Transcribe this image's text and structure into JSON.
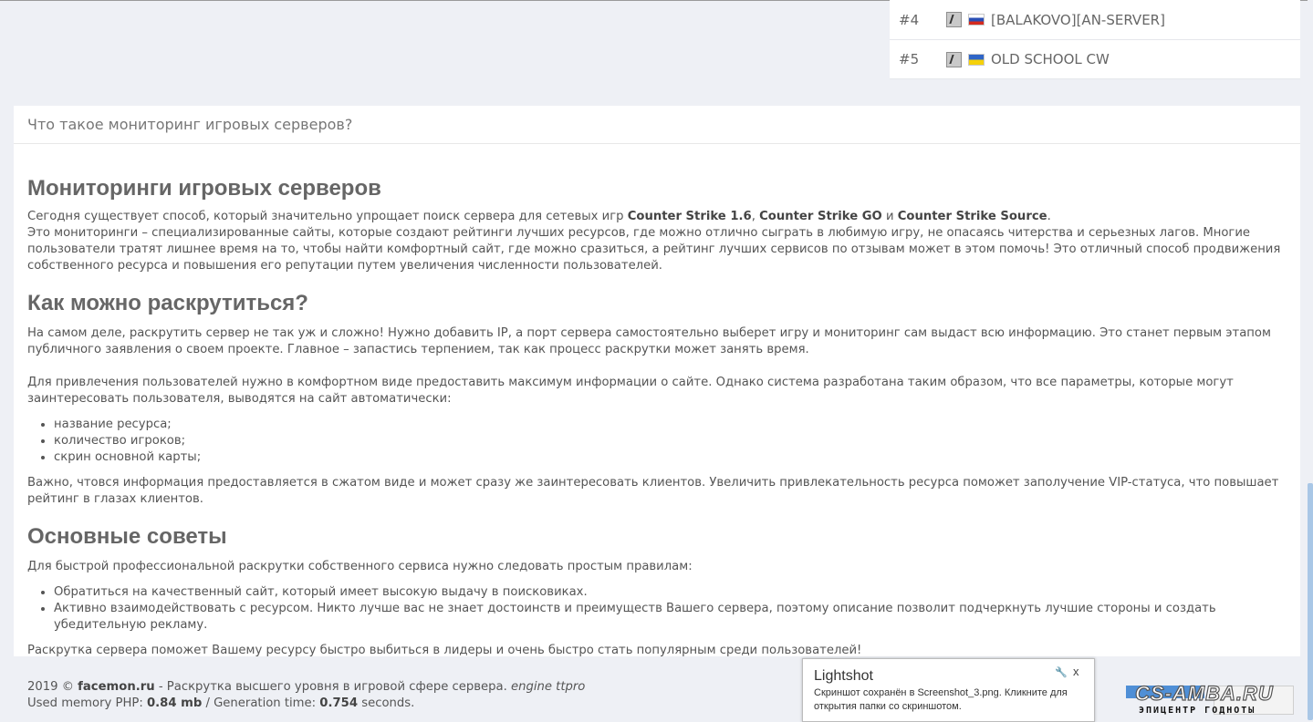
{
  "servers": [
    {
      "rank": "#4",
      "name": "[BALAKOVO][AN-SERVER]",
      "icon": "counter-strike-icon",
      "flag": "russia-flag-icon"
    },
    {
      "rank": "#5",
      "name": "OLD SCHOOL CW",
      "icon": "counter-strike-icon",
      "flag": "ukraine-flag-icon"
    }
  ],
  "faq": {
    "title": "Что такое мониторинг игровых серверов?",
    "h1": "Мониторинги игровых серверов",
    "p1_a": "Сегодня существует способ, который значительно упрощает поиск сервера для сетевых игр ",
    "p1_cs16": "Counter Strike 1.6",
    "p1_comma": ", ",
    "p1_csgo": "Counter Strike GO",
    "p1_and": " и ",
    "p1_css": "Counter Strike Source",
    "p1_dot": ".",
    "p1_b": "Это мониторинги – специализированные сайты, которые создают рейтинги лучших ресурсов, где можно отлично сыграть в любимую игру, не опасаясь читерства и серьезных лагов. Многие пользователи тратят лишнее время на то, чтобы найти комфортный сайт, где можно сразиться, а рейтинг лучших сервисов по отзывам может в этом помочь! Это отличный способ продвижения собственного ресурса и повышения его репутации путем увеличения численности пользователей.",
    "h2": "Как можно раскрутиться?",
    "p2": "На самом деле, раскрутить сервер не так уж и сложно! Нужно добавить IP, а порт сервера самостоятельно выберет игру и мониторинг сам выдаст всю информацию. Это станет первым этапом публичного заявления о своем проекте. Главное – запастись терпением, так как процесс раскрутки может занять время.",
    "p3": "Для привлечения пользователей нужно в комфортном виде предоставить максимум информации о сайте. Однако система разработана таким образом, что все параметры, которые могут заинтересовать пользователя, выводятся на сайт автоматически:",
    "list1": [
      "название ресурса;",
      "количество игроков;",
      "скрин основной карты;"
    ],
    "p4": "Важно, чтовся информация предоставляется в сжатом виде и может сразу же заинтересовать клиентов. Увеличить привлекательность ресурса поможет заполучение VIP-статуса, что повышает рейтинг в глазах клиентов.",
    "h3": "Основные советы",
    "p5": "Для быстрой профессиональной раскрутки собственного сервиса нужно следовать простым правилам:",
    "list2": [
      "Обратиться на качественный сайт, который имеет высокую выдачу в поисковиках.",
      "Активно взаимодействовать с ресурсом. Никто лучше вас не знает достоинств и преимуществ Вашего сервера, поэтому описание позволит подчеркнуть лучшие стороны и создать убедительную рекламу."
    ],
    "p6": "Раскрутка сервера поможет Вашему ресурсу быстро выбиться в лидеры и очень быстро стать популярным среди пользователей!"
  },
  "footer": {
    "year": "2019 © ",
    "site": "facemon.ru",
    "tagline": " - Раскрутка высшего уровня в игровой сфере сервера. ",
    "engine": "engine ttpro",
    "mem_label": "Used memory PHP: ",
    "mem_value": "0.84 mb",
    "gen_label": " / Generation time: ",
    "gen_value": "0.754",
    "gen_unit": " seconds."
  },
  "lightshot": {
    "title": "Lightshot",
    "message": "Скриншот сохранён в Screenshot_3.png. Кликните для открытия папки со скриншотом.",
    "close": "x",
    "settings_icon": "wrench-icon"
  },
  "watermark": {
    "main": "CS-AMBA.RU",
    "sub": "ЭПИЦЕНТР ГОДНОТЫ"
  }
}
